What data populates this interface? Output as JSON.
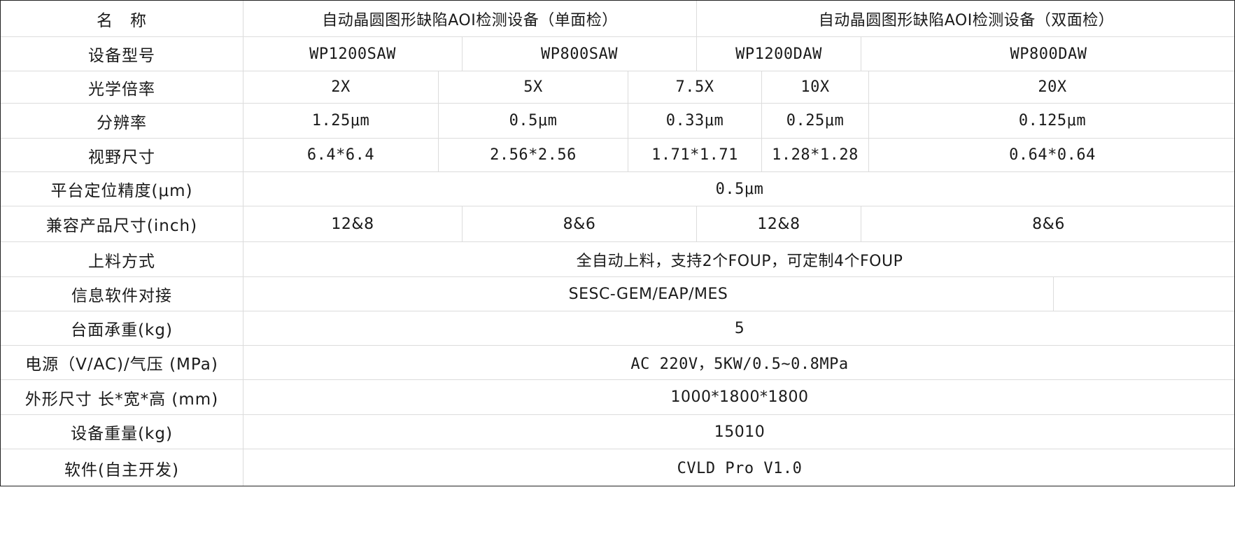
{
  "table": {
    "rows": [
      {
        "label": "名　称",
        "cells": [
          "自动晶圆图形缺陷AOI检测设备（单面检）",
          "自动晶圆图形缺陷AOI检测设备（双面检）"
        ]
      },
      {
        "label": "设备型号",
        "cells": [
          "WP1200SAW",
          "WP800SAW",
          "WP1200DAW",
          "WP800DAW"
        ]
      },
      {
        "label": "光学倍率",
        "cells": [
          "2X",
          "5X",
          "7.5X",
          "10X",
          "20X"
        ]
      },
      {
        "label": "分辨率",
        "cells": [
          "1.25μm",
          "0.5μm",
          "0.33μm",
          "0.25μm",
          "0.125μm"
        ]
      },
      {
        "label": "视野尺寸",
        "cells": [
          "6.4*6.4",
          "2.56*2.56",
          "1.71*1.71",
          "1.28*1.28",
          "0.64*0.64"
        ]
      },
      {
        "label": "平台定位精度(μm)",
        "cells": [
          "0.5μm"
        ]
      },
      {
        "label": "兼容产品尺寸(inch)",
        "cells": [
          "12&8",
          "8&6",
          "12&8",
          "8&6"
        ]
      },
      {
        "label": "上料方式",
        "cells": [
          "全自动上料，支持2个FOUP，可定制4个FOUP"
        ]
      },
      {
        "label": "信息软件对接",
        "cells": [
          "SESC-GEM/EAP/MES",
          ""
        ]
      },
      {
        "label": "台面承重(kg)",
        "cells": [
          "5"
        ]
      },
      {
        "label": "电源（V/AC)/气压 (MPa)",
        "cells": [
          "AC 220V，5KW/0.5~0.8MPa"
        ]
      },
      {
        "label": "外形尺寸 长*宽*高 (mm)",
        "cells": [
          "1000*1800*1800"
        ]
      },
      {
        "label": "设备重量(kg)",
        "cells": [
          "15010"
        ]
      },
      {
        "label": "软件(自主开发)",
        "cells": [
          "CVLD Pro V1.0"
        ]
      }
    ]
  }
}
